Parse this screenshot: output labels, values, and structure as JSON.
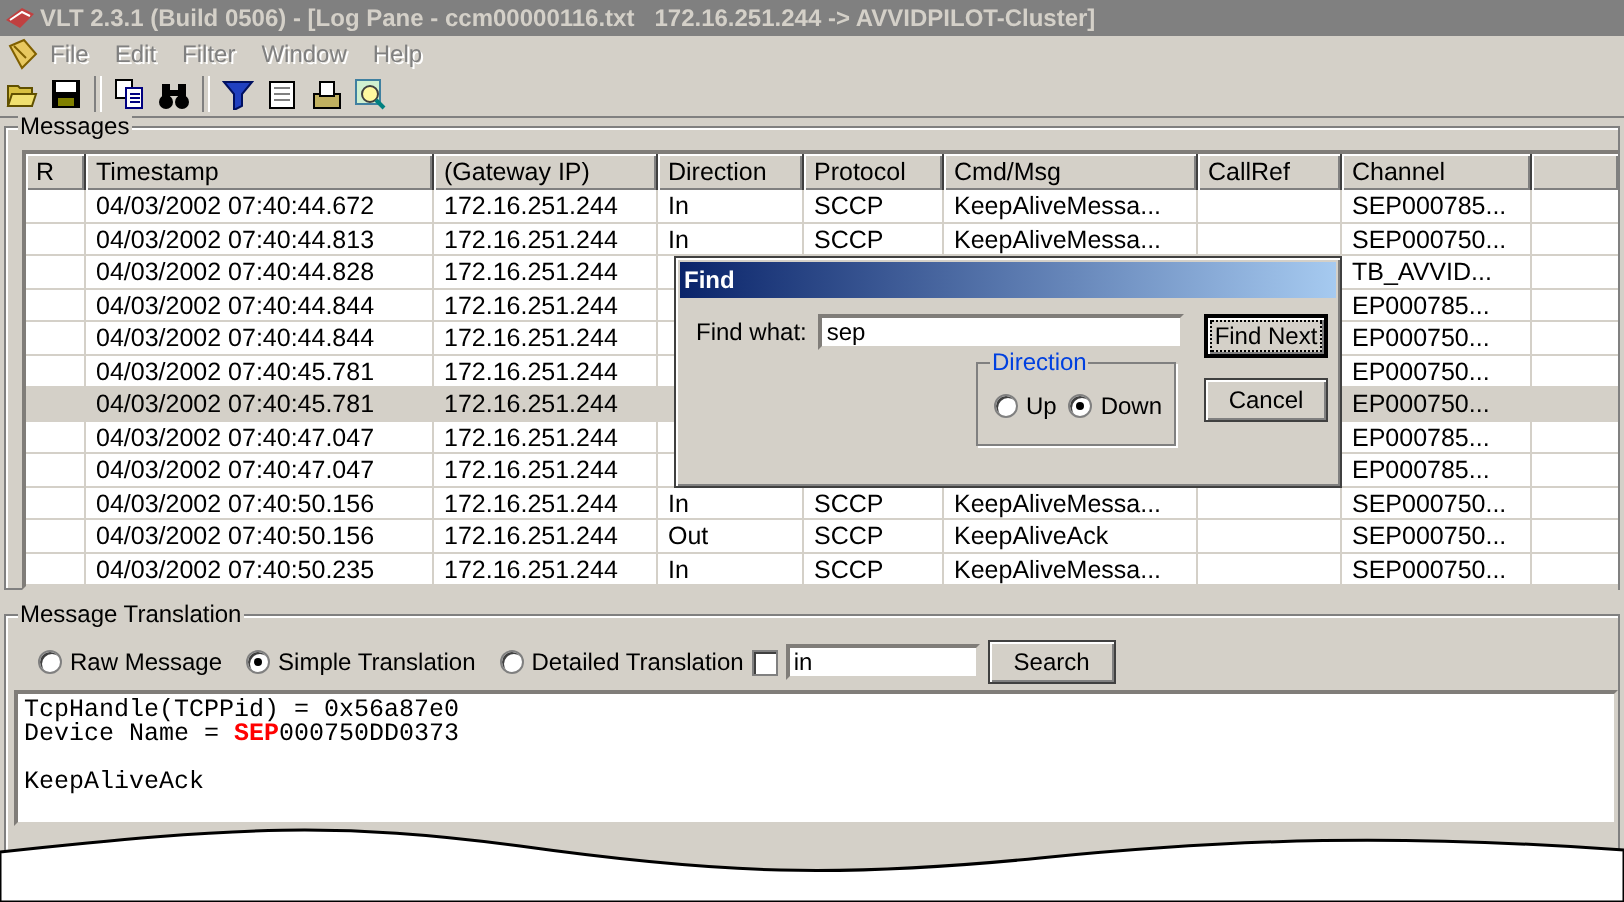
{
  "window": {
    "title": "VLT 2.3.1 (Build 0506) - [Log Pane - ccm00000116.txt   172.16.251.244 -> AVVIDPILOT-Cluster]"
  },
  "menu": [
    {
      "label": "File",
      "disabled": true
    },
    {
      "label": "Edit",
      "disabled": true
    },
    {
      "label": "Filter",
      "disabled": true
    },
    {
      "label": "Window",
      "disabled": true
    },
    {
      "label": "Help",
      "disabled": true
    }
  ],
  "messages": {
    "label": "Messages",
    "columns": [
      "R",
      "Timestamp",
      "(Gateway IP)",
      "Direction",
      "Protocol",
      "Cmd/Msg",
      "CallRef",
      "Channel"
    ],
    "rows": [
      {
        "selected": false,
        "cells": [
          null,
          "04/03/2002 07:40:44.672",
          "172.16.251.244",
          "In",
          "SCCP",
          "KeepAliveMessa...",
          null,
          "SEP000785..."
        ]
      },
      {
        "selected": false,
        "cells": [
          null,
          "04/03/2002 07:40:44.813",
          "172.16.251.244",
          "In",
          "SCCP",
          "KeepAliveMessa...",
          null,
          "SEP000750..."
        ]
      },
      {
        "selected": false,
        "cells": [
          null,
          "04/03/2002 07:40:44.828",
          "172.16.251.244",
          null,
          null,
          null,
          null,
          "TB_AVVID..."
        ]
      },
      {
        "selected": false,
        "cells": [
          null,
          "04/03/2002 07:40:44.844",
          "172.16.251.244",
          null,
          null,
          null,
          null,
          "EP000785..."
        ]
      },
      {
        "selected": false,
        "cells": [
          null,
          "04/03/2002 07:40:44.844",
          "172.16.251.244",
          null,
          null,
          null,
          null,
          "EP000750..."
        ]
      },
      {
        "selected": false,
        "cells": [
          null,
          "04/03/2002 07:40:45.781",
          "172.16.251.244",
          null,
          null,
          null,
          null,
          "EP000750..."
        ]
      },
      {
        "selected": true,
        "cells": [
          null,
          "04/03/2002 07:40:45.781",
          "172.16.251.244",
          null,
          null,
          null,
          null,
          "EP000750..."
        ]
      },
      {
        "selected": false,
        "cells": [
          null,
          "04/03/2002 07:40:47.047",
          "172.16.251.244",
          null,
          null,
          null,
          null,
          "EP000785..."
        ]
      },
      {
        "selected": false,
        "cells": [
          null,
          "04/03/2002 07:40:47.047",
          "172.16.251.244",
          null,
          null,
          null,
          null,
          "EP000785..."
        ]
      },
      {
        "selected": false,
        "cells": [
          null,
          "04/03/2002 07:40:50.156",
          "172.16.251.244",
          "In",
          "SCCP",
          "KeepAliveMessa...",
          null,
          "SEP000750..."
        ]
      },
      {
        "selected": false,
        "cells": [
          null,
          "04/03/2002 07:40:50.156",
          "172.16.251.244",
          "Out",
          "SCCP",
          "KeepAliveAck",
          null,
          "SEP000750..."
        ]
      },
      {
        "selected": false,
        "cells": [
          null,
          "04/03/2002 07:40:50.235",
          "172.16.251.244",
          "In",
          "SCCP",
          "KeepAliveMessa...",
          null,
          "SEP000750..."
        ]
      }
    ]
  },
  "find_dialog": {
    "title": "Find",
    "find_what_label": "Find what:",
    "value": "sep",
    "direction_label": "Direction",
    "directions": [
      {
        "label": "Up",
        "selected": false
      },
      {
        "label": "Down",
        "selected": true
      }
    ],
    "buttons": [
      {
        "label": "Find Next",
        "default": true
      },
      {
        "label": "Cancel",
        "default": false
      }
    ]
  },
  "translation": {
    "label": "Message Translation",
    "modes": [
      {
        "label": "Raw Message",
        "selected": false
      },
      {
        "label": "Simple Translation",
        "selected": true
      },
      {
        "label": "Detailed Translation",
        "selected": false
      }
    ],
    "filter_checked": false,
    "search_value": "in",
    "search_button": "Search",
    "paragraphs": [
      [
        "TcpHandle(TCPPid) = 0x56a87e0",
        "Device Name = **SEP**000750DD0373"
      ],
      [
        "KeepAliveAck"
      ]
    ]
  }
}
